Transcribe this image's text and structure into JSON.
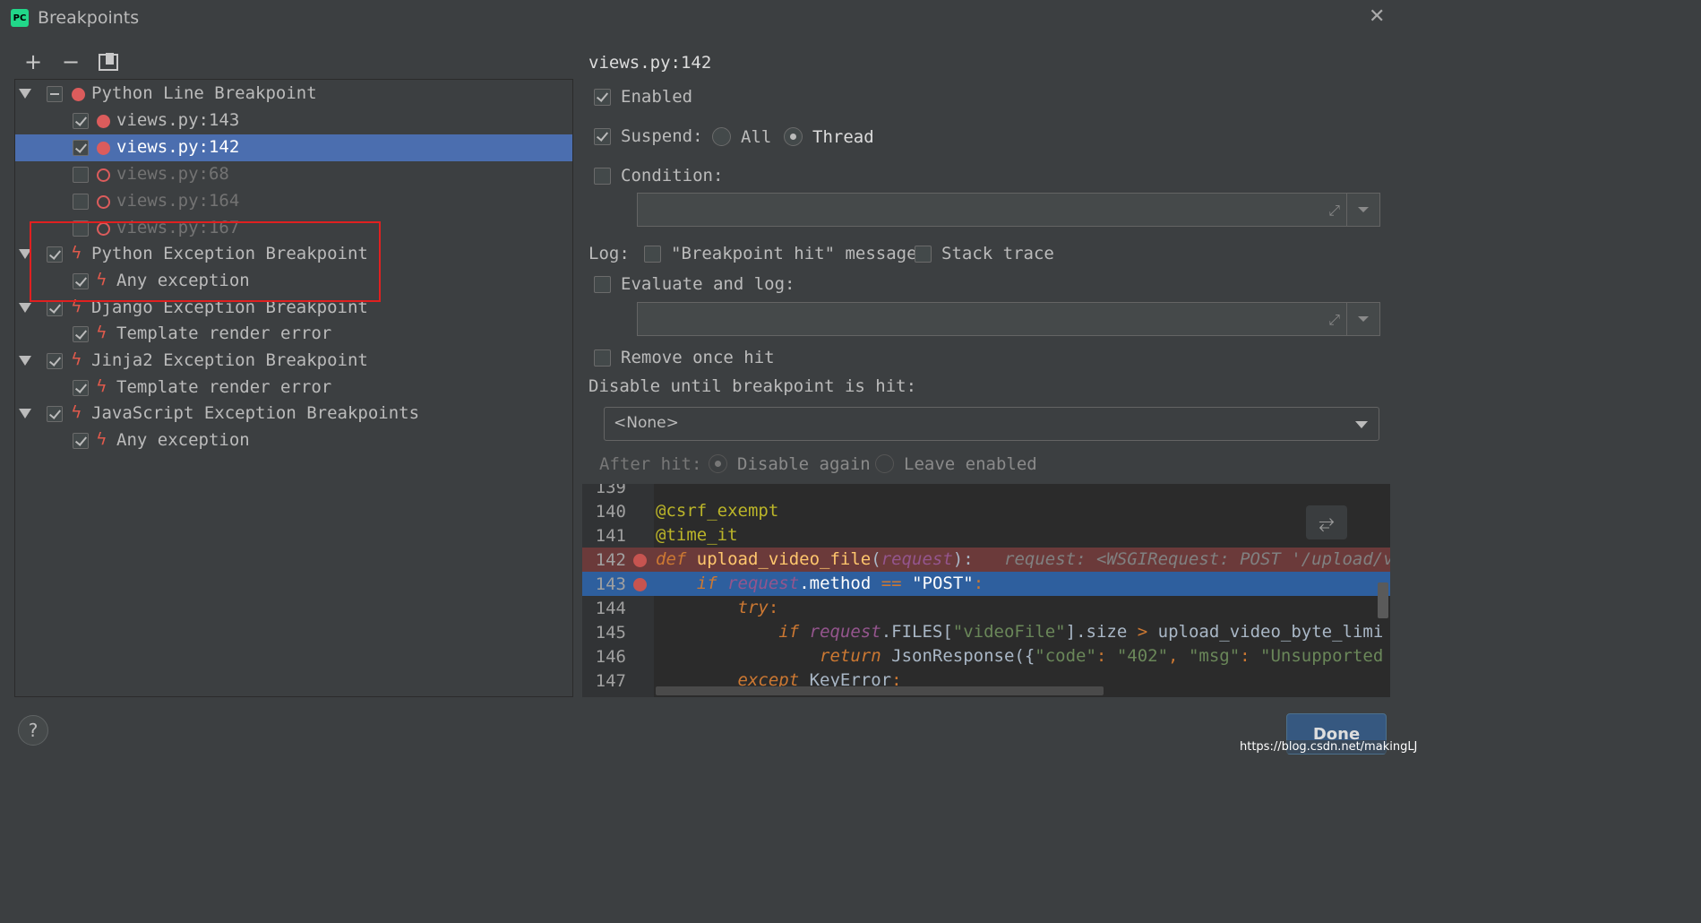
{
  "window": {
    "title": "Breakpoints",
    "app_icon": "PC"
  },
  "toolbar": {
    "add": "+",
    "remove": "−"
  },
  "tree": [
    {
      "label": "Python Line Breakpoint",
      "kind": "group",
      "checked": "mixed",
      "icon": "red-dot"
    },
    {
      "label": "views.py:143",
      "kind": "item",
      "checked": true,
      "icon": "red-dot"
    },
    {
      "label": "views.py:142",
      "kind": "item",
      "checked": true,
      "icon": "red-dot",
      "selected": true
    },
    {
      "label": "views.py:68",
      "kind": "item",
      "checked": false,
      "icon": "red-ring"
    },
    {
      "label": "views.py:164",
      "kind": "item",
      "checked": false,
      "icon": "red-ring"
    },
    {
      "label": "views.py:167",
      "kind": "item",
      "checked": false,
      "icon": "red-ring"
    },
    {
      "label": "Python Exception Breakpoint",
      "kind": "group",
      "checked": true,
      "icon": "lightning"
    },
    {
      "label": "Any exception",
      "kind": "item",
      "checked": true,
      "icon": "lightning"
    },
    {
      "label": "Django Exception Breakpoint",
      "kind": "group",
      "checked": true,
      "icon": "lightning"
    },
    {
      "label": "Template render error",
      "kind": "item",
      "checked": true,
      "icon": "lightning"
    },
    {
      "label": "Jinja2 Exception Breakpoint",
      "kind": "group",
      "checked": true,
      "icon": "lightning"
    },
    {
      "label": "Template render error",
      "kind": "item",
      "checked": true,
      "icon": "lightning"
    },
    {
      "label": "JavaScript Exception Breakpoints",
      "kind": "group",
      "checked": true,
      "icon": "lightning"
    },
    {
      "label": "Any exception",
      "kind": "item",
      "checked": true,
      "icon": "lightning"
    }
  ],
  "details": {
    "heading": "views.py:142",
    "enabled_label": "Enabled",
    "suspend_label": "Suspend:",
    "all_label": "All",
    "thread_label": "Thread",
    "condition_label": "Condition:",
    "log_label": "Log:",
    "hit_message_label": "\"Breakpoint hit\" message",
    "stack_trace_label": "Stack trace",
    "evaluate_label": "Evaluate and log:",
    "remove_once_label": "Remove once hit",
    "disable_until_label": "Disable until breakpoint is hit:",
    "disable_until_value": "<None>",
    "after_hit_label": "After hit:",
    "disable_again_label": "Disable again",
    "leave_enabled_label": "Leave enabled"
  },
  "editor": {
    "lines": [
      {
        "num": "139"
      },
      {
        "num": "140",
        "text": "@csrf_exempt"
      },
      {
        "num": "141",
        "text": "@time_it"
      },
      {
        "num": "142",
        "t1": "def",
        "t2": "upload_video_file",
        "t3": "(",
        "t4": "request",
        "t5": "):",
        "t6": "request: <WSGIRequest: POST '/upload/v"
      },
      {
        "num": "143",
        "t1": "if",
        "t2": "request",
        "t3": ".method",
        "t4": "==",
        "t5": "\"POST\"",
        "t6": ":"
      },
      {
        "num": "144",
        "t1": "try",
        "t2": ":"
      },
      {
        "num": "145",
        "t1": "if",
        "t2": "request",
        "t3": ".FILES[",
        "t4": "\"videoFile\"",
        "t5": "].size",
        "t6": ">",
        "t7": "upload_video_byte_limi"
      },
      {
        "num": "146",
        "t1": "return",
        "t2": "JsonResponse({",
        "t3": "\"code\"",
        "t4": ":",
        "t5": "\"402\"",
        "t6": ",",
        "t7": "\"msg\"",
        "t8": ":",
        "t9": "\"Unsupported"
      },
      {
        "num": "147",
        "t1": "except",
        "t2": "KeyError",
        "t3": ":"
      }
    ]
  },
  "footer": {
    "help": "?",
    "done": "Done",
    "watermark": "https://blog.csdn.net/makingLJ"
  }
}
